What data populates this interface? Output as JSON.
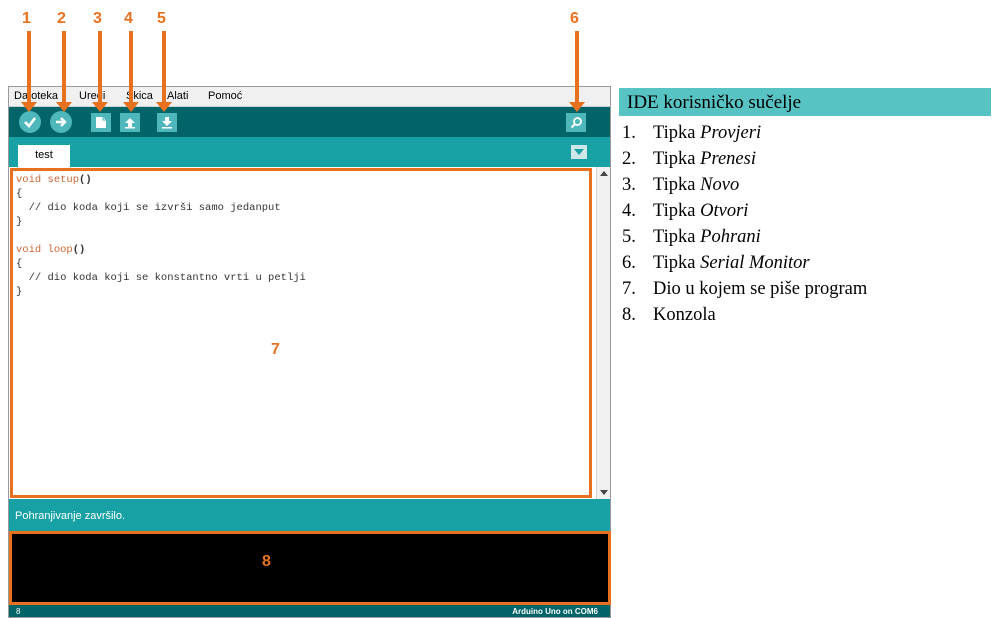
{
  "annotation_color": "#e8711f",
  "window": {
    "menu": [
      "Datoteka",
      "Uredi",
      "Skica",
      "Alati",
      "Pomoć"
    ],
    "toolbar": {
      "verify_icon": "check-icon",
      "upload_icon": "arrow-right-icon",
      "new_icon": "new-file-icon",
      "open_icon": "arrow-up-icon",
      "save_icon": "arrow-down-icon",
      "serial_icon": "magnifier-icon"
    },
    "tab_name": "test",
    "code": {
      "line1_kw": "void",
      "line1_fn": "setup",
      "line1_rest": "()",
      "line2": "{",
      "line3": "  // dio koda koji se izvrši samo jedanput",
      "line4": "}",
      "line6_kw": "void",
      "line6_fn": "loop",
      "line6_rest": "()",
      "line7": "{",
      "line8": "  // dio koda koji se konstantno vrti u petlji",
      "line9": "}"
    },
    "status_text": "Pohranjivanje završilo.",
    "line_number": "8",
    "board": "Arduino Uno on COM6"
  },
  "markers": [
    "1",
    "2",
    "3",
    "4",
    "5",
    "6",
    "7",
    "8"
  ],
  "legend": {
    "title": "IDE korisničko sučelje",
    "items": [
      {
        "num": "1.",
        "prefix": "Tipka ",
        "name": "Provjeri"
      },
      {
        "num": "2.",
        "prefix": "Tipka ",
        "name": "Prenesi"
      },
      {
        "num": "3.",
        "prefix": "Tipka ",
        "name": "Novo"
      },
      {
        "num": "4.",
        "prefix": "Tipka ",
        "name": "Otvori"
      },
      {
        "num": "5.",
        "prefix": "Tipka ",
        "name": "Pohrani"
      },
      {
        "num": "6.",
        "prefix": "Tipka ",
        "name": "Serial Monitor"
      },
      {
        "num": "7.",
        "prefix": "Dio u kojem se piše program",
        "name": ""
      },
      {
        "num": "8.",
        "prefix": "Konzola",
        "name": ""
      }
    ]
  }
}
